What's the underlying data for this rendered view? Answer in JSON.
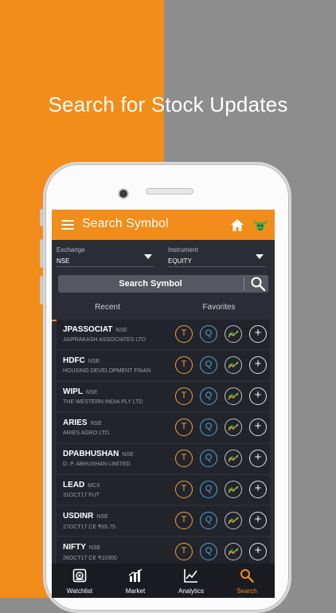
{
  "headline": "Search for Stock Updates",
  "appbar": {
    "title": "Search Symbol"
  },
  "selectors": {
    "exchange": {
      "label": "Exchange",
      "value": "NSE"
    },
    "instrument": {
      "label": "Instrument",
      "value": "EQUITY"
    }
  },
  "search": {
    "label": "Search Symbol"
  },
  "tabs": [
    {
      "label": "Recent"
    },
    {
      "label": "Favorites"
    }
  ],
  "buttons": {
    "t": "T",
    "q": "Q",
    "plus": "+"
  },
  "rows": [
    {
      "symbol": "JPASSOCIAT",
      "exchange": "NSE",
      "desc": "JAIPRAKASH ASSOCIATES LTD"
    },
    {
      "symbol": "HDFC",
      "exchange": "NSE",
      "desc": "HOUSING DEVELOPMENT FINAN"
    },
    {
      "symbol": "WIPL",
      "exchange": "NSE",
      "desc": "THE WESTERN INDIA PLY LTD"
    },
    {
      "symbol": "ARIES",
      "exchange": "NSE",
      "desc": "ARIES AGRO LTD."
    },
    {
      "symbol": "DPABHUSHAN",
      "exchange": "NSE",
      "desc": "D. P. ABHUSHAN LIMITED"
    },
    {
      "symbol": "LEAD",
      "exchange": "MCX",
      "desc": "31OCT17 FUT"
    },
    {
      "symbol": "USDINR",
      "exchange": "NSE",
      "desc": "27OCT17 CE ₹65.75"
    },
    {
      "symbol": "NIFTY",
      "exchange": "NSE",
      "desc": "26OCT17 CE ₹10300"
    }
  ],
  "bottom_nav": [
    {
      "label": "Watchlist",
      "icon": "watchlist-icon"
    },
    {
      "label": "Market",
      "icon": "bar-chart-icon"
    },
    {
      "label": "Analytics",
      "icon": "analytics-icon"
    },
    {
      "label": "Search",
      "icon": "search-icon"
    }
  ],
  "colors": {
    "accent": "#f28c1a",
    "gray_bg": "#8d8d8d",
    "dark_bg": "#2b2d36",
    "q_blue": "#4fa6d8"
  }
}
